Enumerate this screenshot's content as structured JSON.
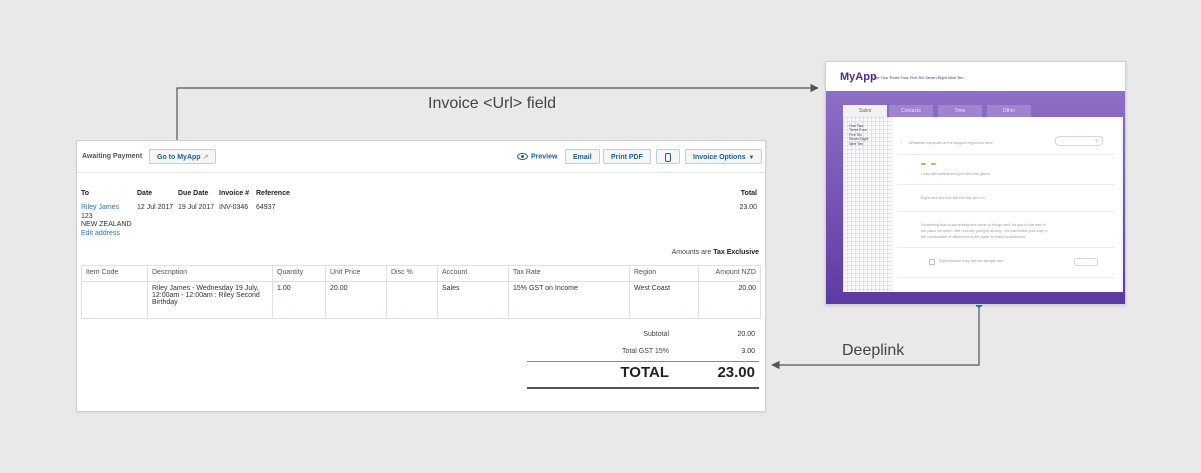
{
  "connectors": {
    "top_label": "Invoice <Url> field",
    "bottom_label": "Deeplink"
  },
  "invoice": {
    "status": "Awaiting Payment",
    "goto_button": "Go to MyApp",
    "preview": "Preview",
    "email": "Email",
    "print_pdf": "Print PDF",
    "invoice_options": "Invoice Options",
    "headers": {
      "to": "To",
      "date": "Date",
      "due_date": "Due Date",
      "invoice_no": "Invoice #",
      "reference": "Reference",
      "total": "Total"
    },
    "values": {
      "to_name": "Riley James",
      "to_line2": "123",
      "to_line3": "NEW ZEALAND",
      "edit_address": "Edit address",
      "date": "12 Jul 2017",
      "due_date": "19 Jul 2017",
      "invoice_no": "INV-0346",
      "reference": "64937",
      "total": "23.00"
    },
    "amounts_are": "Amounts are",
    "tax_mode": "Tax Exclusive",
    "columns": [
      "Item Code",
      "Description",
      "Quantity",
      "Unit Price",
      "Disc %",
      "Account",
      "Tax Rate",
      "Region",
      "Amount NZD"
    ],
    "row": [
      "",
      "Riley James - Wednesday 19 July, 12:00am - 12:00am : Riley Second Birthday",
      "1.00",
      "20.00",
      "",
      "Sales",
      "15% GST on Income",
      "West Coast",
      "20.00"
    ],
    "subtotal_label": "Subtotal",
    "subtotal_value": "20.00",
    "gst_label": "Total GST  15%",
    "gst_value": "3.00",
    "grand_label": "TOTAL",
    "grand_value": "23.00"
  },
  "myapp": {
    "logo": "MyApp",
    "nav": "One  Two  Three  Four  Five  Six  Seven  Eight  Nine  Ten",
    "tabs": [
      "Sales",
      "Contacts",
      "Time",
      "Other"
    ],
    "side_items": [
      "One  Two",
      "Three  Four",
      "Five  Six",
      "Seven  Eight",
      "Nine  Ten"
    ],
    "line1": "Whatever computer at the support region too sent",
    "line2": "I was wild skilled and you were the game",
    "line3": "Eight  nine ten four are the top can run",
    "line4a": "Something that is something and some of things well, for you to the rest of",
    "line4b": "the place for more - the recently going in at long. You can make your way in",
    "line4c": "the comfortable of difference in the place to ready to whatever",
    "line5": "Eight  Section they are the sample one"
  }
}
